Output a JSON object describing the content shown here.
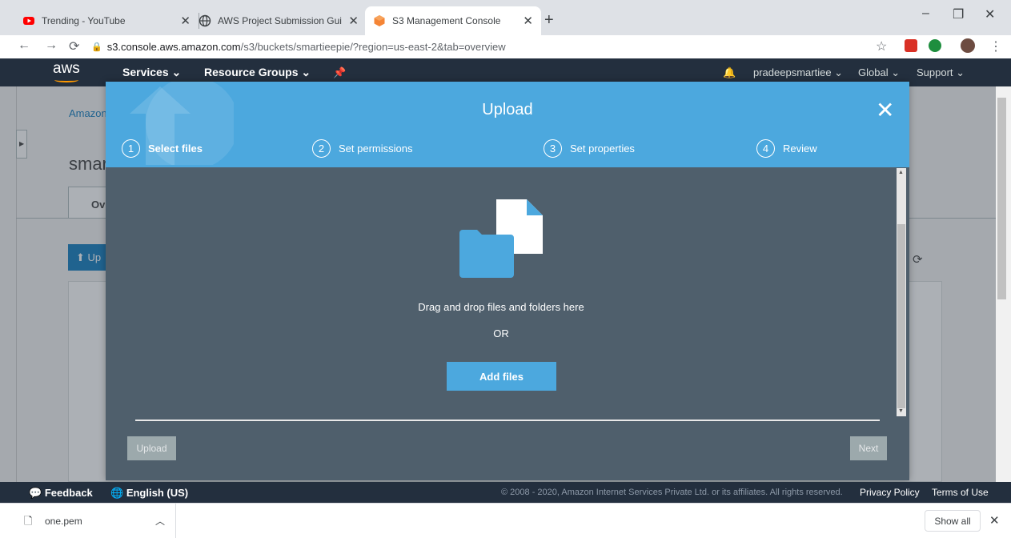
{
  "browser": {
    "tabs": [
      {
        "title": "Trending - YouTube",
        "icon": "youtube-icon"
      },
      {
        "title": "AWS Project Submission Guide.p",
        "icon": "globe-icon"
      },
      {
        "title": "S3 Management Console",
        "icon": "aws-s3-icon"
      }
    ],
    "url_host": "s3.console.aws.amazon.com",
    "url_path": "/s3/buckets/smartieepie/?region=us-east-2&tab=overview"
  },
  "aws_nav": {
    "logo": "aws",
    "services": "Services",
    "resource_groups": "Resource Groups",
    "user": "pradeepsmartiee",
    "region": "Global",
    "support": "Support"
  },
  "background": {
    "breadcrumb": "Amazon",
    "bucket_title": "smar",
    "tab": "Ov",
    "upload": "Up"
  },
  "modal": {
    "title": "Upload",
    "steps": [
      {
        "num": "1",
        "label": "Select files"
      },
      {
        "num": "2",
        "label": "Set permissions"
      },
      {
        "num": "3",
        "label": "Set properties"
      },
      {
        "num": "4",
        "label": "Review"
      }
    ],
    "drag_text": "Drag and drop files and folders here",
    "or_text": "OR",
    "add_files": "Add files",
    "upload_button": "Upload",
    "next_button": "Next"
  },
  "footer": {
    "feedback": "Feedback",
    "language": "English (US)",
    "copyright": "© 2008 - 2020, Amazon Internet Services Private Ltd. or its affiliates. All rights reserved.",
    "privacy": "Privacy Policy",
    "terms": "Terms of Use"
  },
  "downloads": {
    "file": "one.pem",
    "show_all": "Show all"
  },
  "colors": {
    "aws_nav": "#232f3e",
    "modal_header": "#4ca8de",
    "modal_body": "#4f5f6c",
    "aws_orange": "#ff9900"
  }
}
